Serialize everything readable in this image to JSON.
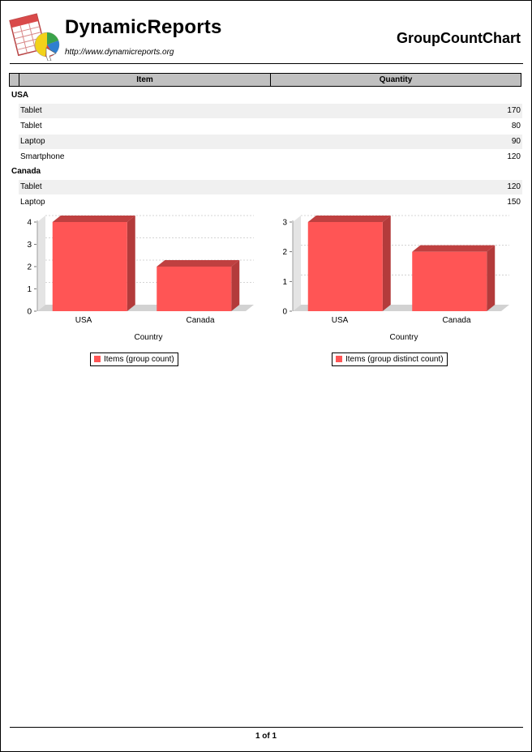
{
  "header": {
    "brand_name": "DynamicReports",
    "brand_url": "http://www.dynamicreports.org",
    "report_title": "GroupCountChart"
  },
  "table": {
    "columns": [
      "Item",
      "Quantity"
    ],
    "groups": [
      {
        "name": "USA",
        "rows": [
          {
            "item": "Tablet",
            "quantity": "170"
          },
          {
            "item": "Tablet",
            "quantity": "80"
          },
          {
            "item": "Laptop",
            "quantity": "90"
          },
          {
            "item": "Smartphone",
            "quantity": "120"
          }
        ]
      },
      {
        "name": "Canada",
        "rows": [
          {
            "item": "Tablet",
            "quantity": "120"
          },
          {
            "item": "Laptop",
            "quantity": "150"
          }
        ]
      }
    ]
  },
  "chart_data": [
    {
      "type": "bar",
      "categories": [
        "USA",
        "Canada"
      ],
      "series": [
        {
          "name": "Items (group count)",
          "values": [
            4,
            2
          ]
        }
      ],
      "xlabel": "Country",
      "ylabel": "",
      "ylim": [
        0,
        4
      ],
      "yticks": [
        "0",
        "1",
        "2",
        "3",
        "4"
      ],
      "grid": true,
      "legend": "bottom",
      "color": "#ff5555"
    },
    {
      "type": "bar",
      "categories": [
        "USA",
        "Canada"
      ],
      "series": [
        {
          "name": "Items (group distinct count)",
          "values": [
            3,
            2
          ]
        }
      ],
      "xlabel": "Country",
      "ylabel": "",
      "ylim": [
        0,
        3
      ],
      "yticks": [
        "0",
        "1",
        "2",
        "3"
      ],
      "grid": true,
      "legend": "bottom",
      "color": "#ff5555"
    }
  ],
  "footer": {
    "page_number": "1 of 1"
  }
}
